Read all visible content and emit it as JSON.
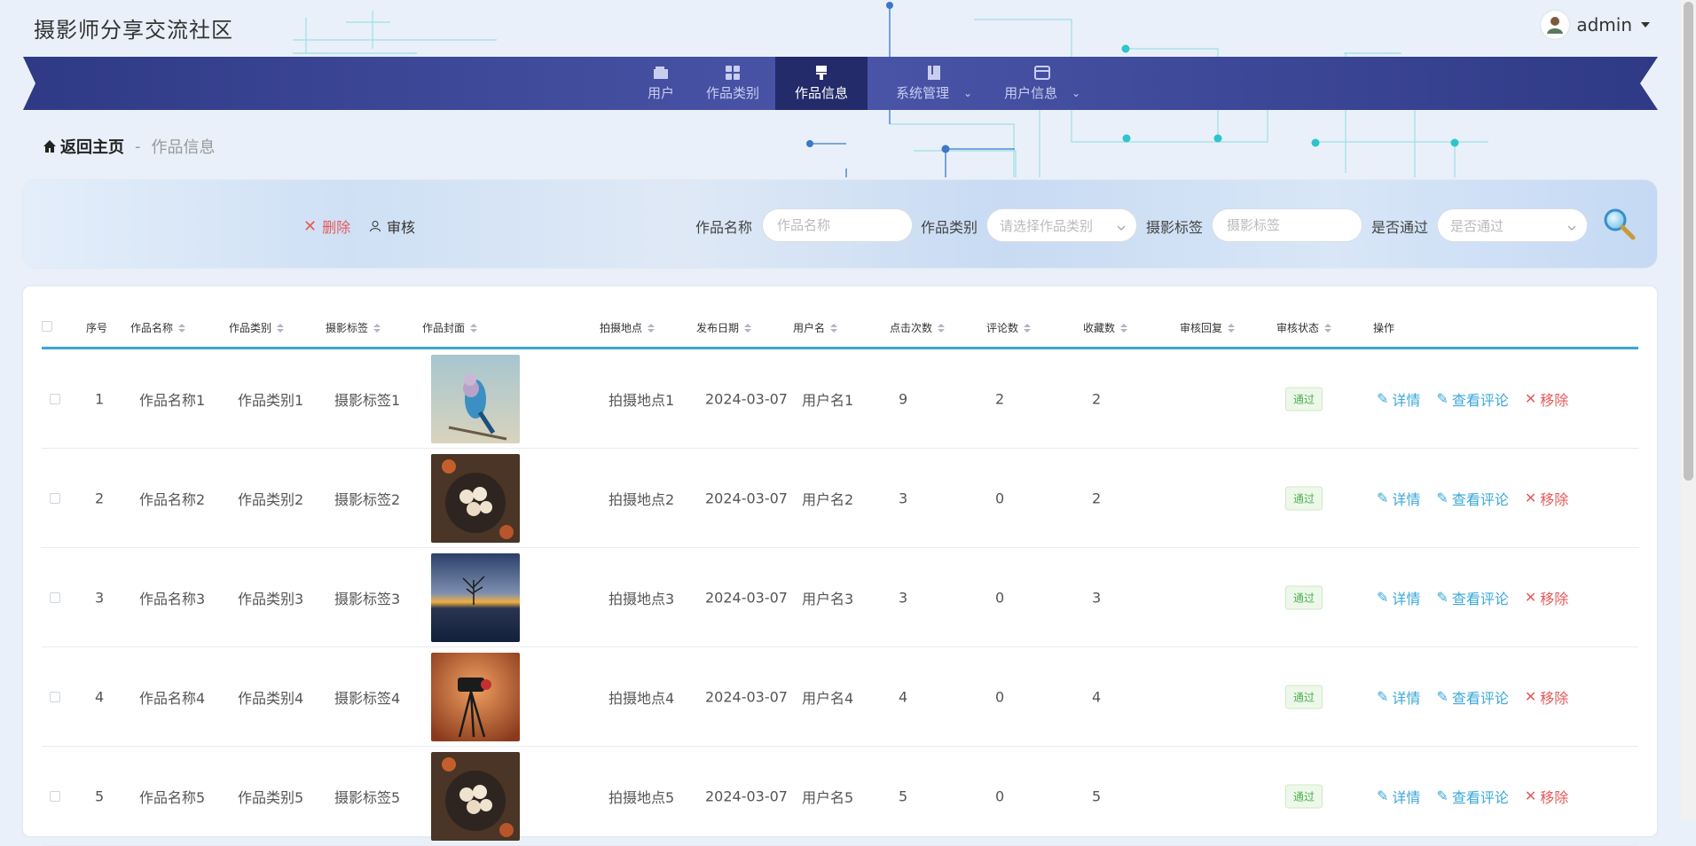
{
  "app": {
    "title": "摄影师分享交流社区"
  },
  "user_menu": {
    "name": "admin"
  },
  "nav": {
    "items": [
      {
        "label": "用户",
        "icon": "wallet-icon"
      },
      {
        "label": "作品类别",
        "icon": "grid-icon"
      },
      {
        "label": "作品信息",
        "icon": "brush-icon",
        "active": true
      },
      {
        "label": "系统管理",
        "icon": "book-icon",
        "dropdown": true
      },
      {
        "label": "用户信息",
        "icon": "card-icon",
        "dropdown": true
      }
    ]
  },
  "breadcrumb": {
    "home": "返回主页",
    "separator": "-",
    "current": "作品信息"
  },
  "toolbar": {
    "delete_label": "删除",
    "audit_label": "审核"
  },
  "search": {
    "name_label": "作品名称",
    "name_placeholder": "作品名称",
    "category_label": "作品类别",
    "category_placeholder": "请选择作品类别",
    "tag_label": "摄影标签",
    "tag_placeholder": "摄影标签",
    "passed_label": "是否通过",
    "passed_placeholder": "是否通过"
  },
  "table": {
    "headers": {
      "index": "序号",
      "name": "作品名称",
      "category": "作品类别",
      "tag": "摄影标签",
      "cover": "作品封面",
      "location": "拍摄地点",
      "date": "发布日期",
      "user": "用户名",
      "clicks": "点击次数",
      "comments": "评论数",
      "favorites": "收藏数",
      "reply": "审核回复",
      "status": "审核状态",
      "ops": "操作"
    },
    "actions": {
      "detail": "详情",
      "view_comments": "查看评论",
      "remove": "移除"
    },
    "rows": [
      {
        "index": "1",
        "name": "作品名称1",
        "category": "作品类别1",
        "tag": "摄影标签1",
        "cover": "bird",
        "location": "拍摄地点1",
        "date": "2024-03-07",
        "user": "用户名1",
        "clicks": "9",
        "comments": "2",
        "favorites": "2",
        "reply": "",
        "status": "通过"
      },
      {
        "index": "2",
        "name": "作品名称2",
        "category": "作品类别2",
        "tag": "摄影标签2",
        "cover": "food",
        "location": "拍摄地点2",
        "date": "2024-03-07",
        "user": "用户名2",
        "clicks": "3",
        "comments": "0",
        "favorites": "2",
        "reply": "",
        "status": "通过"
      },
      {
        "index": "3",
        "name": "作品名称3",
        "category": "作品类别3",
        "tag": "摄影标签3",
        "cover": "sunset",
        "location": "拍摄地点3",
        "date": "2024-03-07",
        "user": "用户名3",
        "clicks": "3",
        "comments": "0",
        "favorites": "3",
        "reply": "",
        "status": "通过"
      },
      {
        "index": "4",
        "name": "作品名称4",
        "category": "作品类别4",
        "tag": "摄影标签4",
        "cover": "camera",
        "location": "拍摄地点4",
        "date": "2024-03-07",
        "user": "用户名4",
        "clicks": "4",
        "comments": "0",
        "favorites": "4",
        "reply": "",
        "status": "通过"
      },
      {
        "index": "5",
        "name": "作品名称5",
        "category": "作品类别5",
        "tag": "摄影标签5",
        "cover": "food",
        "location": "拍摄地点5",
        "date": "2024-03-07",
        "user": "用户名5",
        "clicks": "5",
        "comments": "0",
        "favorites": "5",
        "reply": "",
        "status": "通过"
      }
    ]
  },
  "colors": {
    "nav_bg": "#3c4796",
    "nav_active": "#232b6b",
    "accent": "#3aa7d8",
    "danger": "#e55a5a",
    "success": "#4caf50"
  }
}
